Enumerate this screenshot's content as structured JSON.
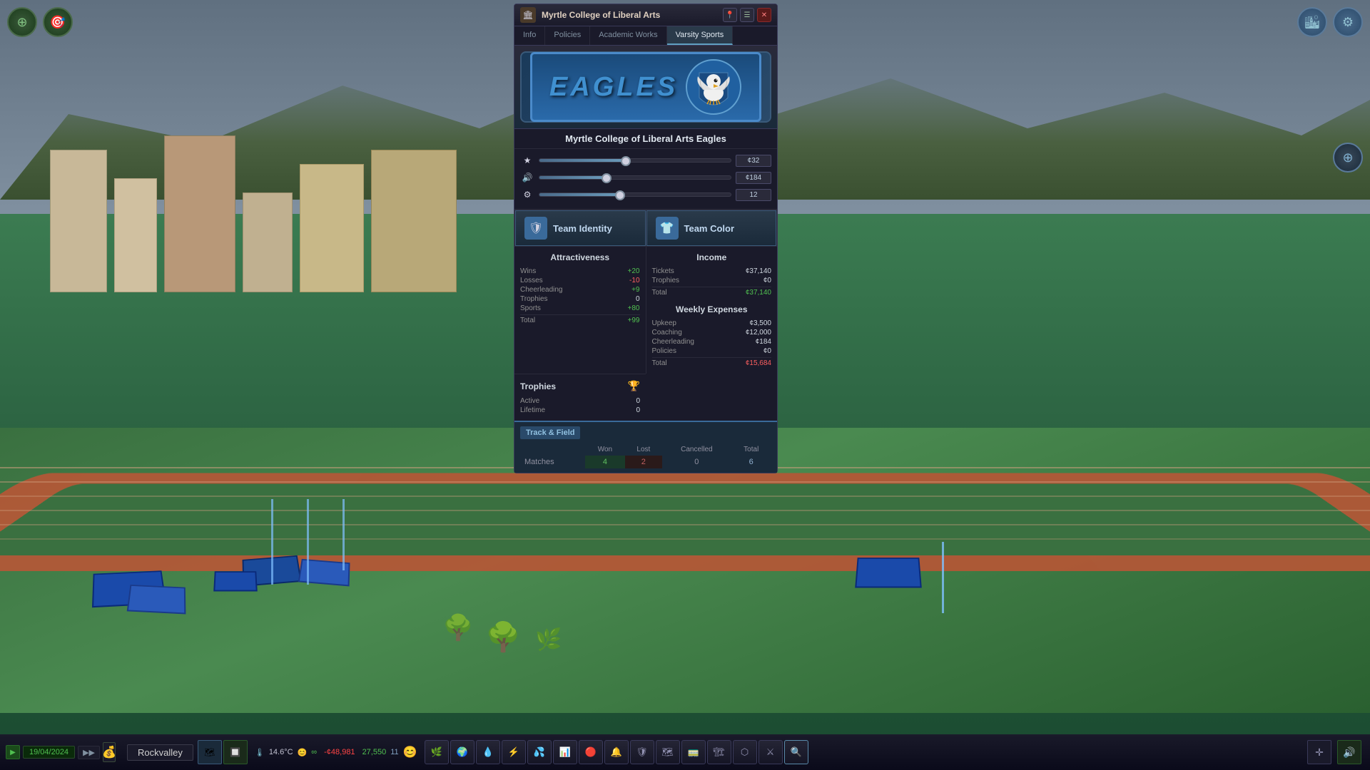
{
  "window": {
    "title": "Myrtle College of Liberal Arts",
    "close_btn": "✕",
    "location_icon": "📍",
    "list_icon": "☰"
  },
  "tabs": [
    {
      "label": "Info",
      "active": false
    },
    {
      "label": "Policies",
      "active": false
    },
    {
      "label": "Academic Works",
      "active": false
    },
    {
      "label": "Varsity Sports",
      "active": true
    }
  ],
  "team": {
    "name": "Myrtle College of Liberal Arts Eagles",
    "logo_text": "EAGLES"
  },
  "sliders": [
    {
      "icon": "★",
      "value": "¢32",
      "percent": 45
    },
    {
      "icon": "🔊",
      "value": "¢184",
      "percent": 35
    },
    {
      "icon": "⚙",
      "value": "12",
      "percent": 42
    }
  ],
  "team_buttons": {
    "identity_label": "Team Identity",
    "color_label": "Team Color"
  },
  "attractiveness": {
    "title": "Attractiveness",
    "rows": [
      {
        "label": "Wins",
        "value": "+20"
      },
      {
        "label": "Losses",
        "value": "-10"
      },
      {
        "label": "Cheerleading",
        "value": "+9"
      },
      {
        "label": "Trophies",
        "value": "0"
      },
      {
        "label": "Sports",
        "value": "+80"
      },
      {
        "label": "Total",
        "value": "+99"
      }
    ]
  },
  "income": {
    "title": "Income",
    "rows": [
      {
        "label": "Tickets",
        "value": "¢37,140"
      },
      {
        "label": "Trophies",
        "value": "¢0"
      },
      {
        "label": "Total",
        "value": "¢37,140"
      }
    ]
  },
  "trophies": {
    "title": "Trophies",
    "icon": "🏆",
    "rows": [
      {
        "label": "Active",
        "value": "0"
      },
      {
        "label": "Lifetime",
        "value": "0"
      }
    ]
  },
  "weekly_expenses": {
    "title": "Weekly Expenses",
    "rows": [
      {
        "label": "Upkeep",
        "value": "¢3,500"
      },
      {
        "label": "Coaching",
        "value": "¢12,000"
      },
      {
        "label": "Cheerleading",
        "value": "¢184"
      },
      {
        "label": "Policies",
        "value": "¢0"
      },
      {
        "label": "Total",
        "value": "¢15,684"
      }
    ]
  },
  "sports_section": {
    "title": "Track & Field",
    "table_headers": [
      "",
      "Won",
      "Lost",
      "Cancelled",
      "Total"
    ],
    "rows": [
      {
        "label": "Matches",
        "won": "4",
        "lost": "2",
        "cancelled": "0",
        "total": "6"
      }
    ]
  },
  "taskbar": {
    "play_icon": "▶",
    "date": "19/04/2024",
    "skip_icon": "▶▶",
    "city": "Rockvalley",
    "temperature": "14.6°C",
    "happiness": "∞",
    "money_neg": "-¢48,981",
    "money_pos": "27,550",
    "speed": "11"
  },
  "top_left_buttons": [
    {
      "icon": "⊕",
      "name": "zoom-button"
    },
    {
      "icon": "🎯",
      "name": "target-button"
    }
  ],
  "top_right_buttons": [
    {
      "icon": "🏙",
      "name": "city-view-button"
    },
    {
      "icon": "⚙",
      "name": "settings-button"
    }
  ],
  "toolbar_icons": [
    "🌿",
    "🌍",
    "💧",
    "⚡",
    "💦",
    "📊",
    "🔴",
    "🔔",
    "🛡",
    "🗺",
    "🚃",
    "🏗",
    "⬡",
    "⚔",
    "🔍"
  ]
}
